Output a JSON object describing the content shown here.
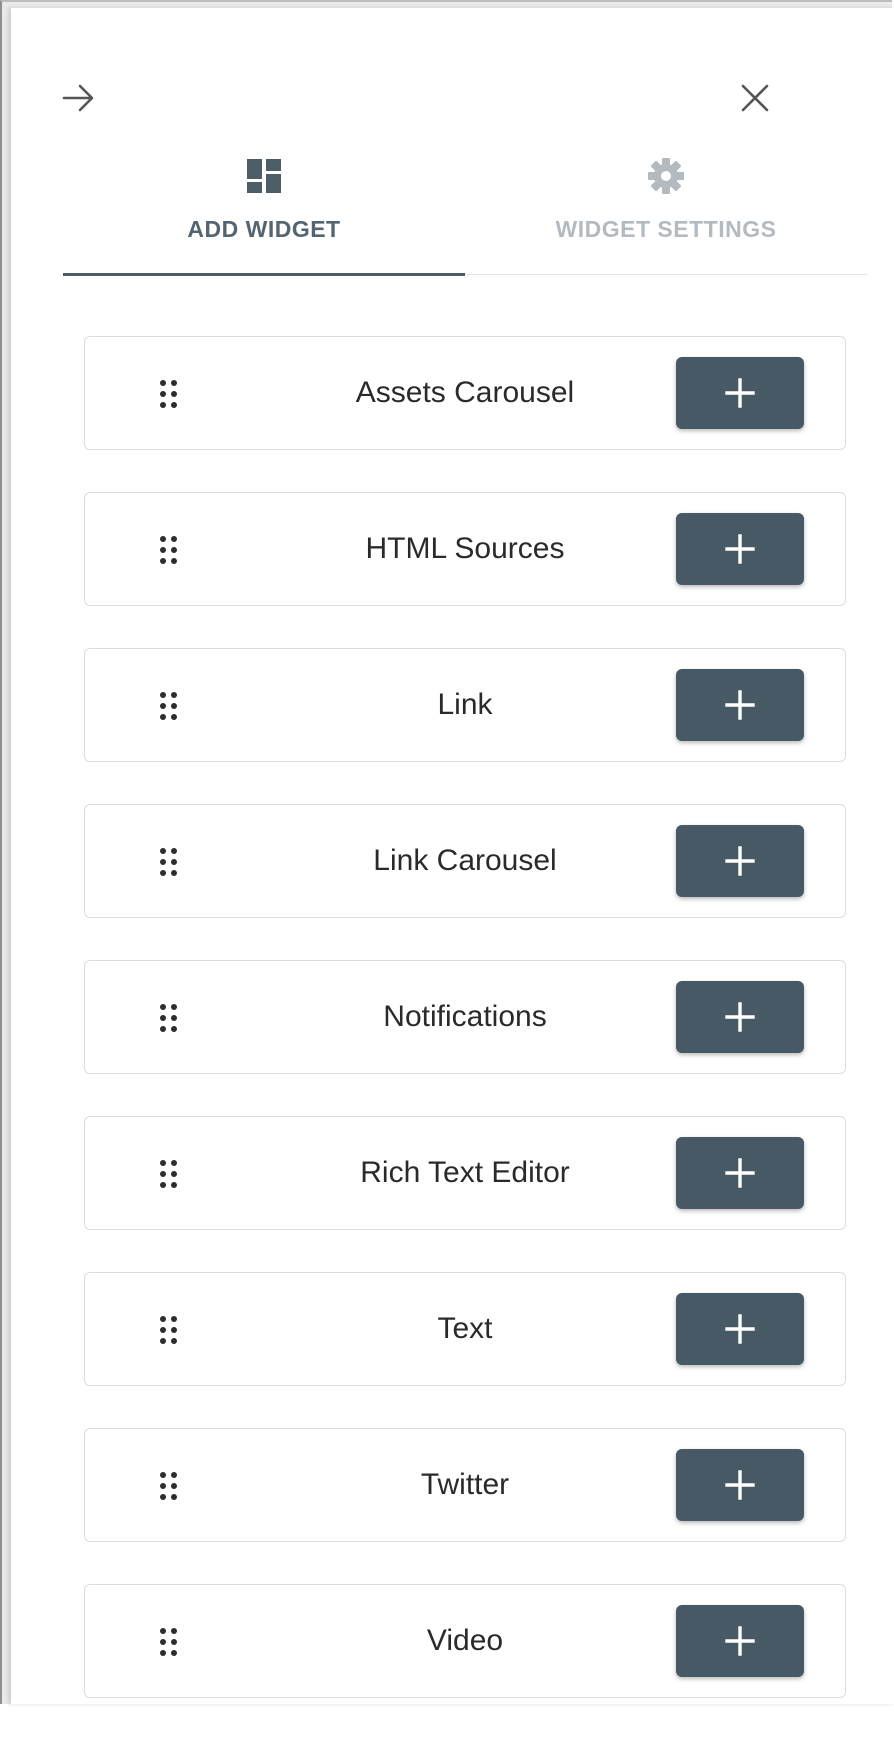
{
  "header": {
    "back_icon": "arrow-right-icon",
    "close_icon": "close-icon"
  },
  "tabs": [
    {
      "label": "ADD WIDGET",
      "icon": "dashboard-icon",
      "active": true
    },
    {
      "label": "WIDGET SETTINGS",
      "icon": "gear-icon",
      "active": false
    }
  ],
  "widgets": [
    {
      "label": "Assets Carousel"
    },
    {
      "label": "HTML Sources"
    },
    {
      "label": "Link"
    },
    {
      "label": "Link Carousel"
    },
    {
      "label": "Notifications"
    },
    {
      "label": "Rich Text Editor"
    },
    {
      "label": "Text"
    },
    {
      "label": "Twitter"
    },
    {
      "label": "Video"
    }
  ],
  "colors": {
    "accent": "#465964",
    "active_tab_text": "#546470",
    "inactive_tab_text": "#b3bac0",
    "card_border": "#dcdcdc"
  }
}
